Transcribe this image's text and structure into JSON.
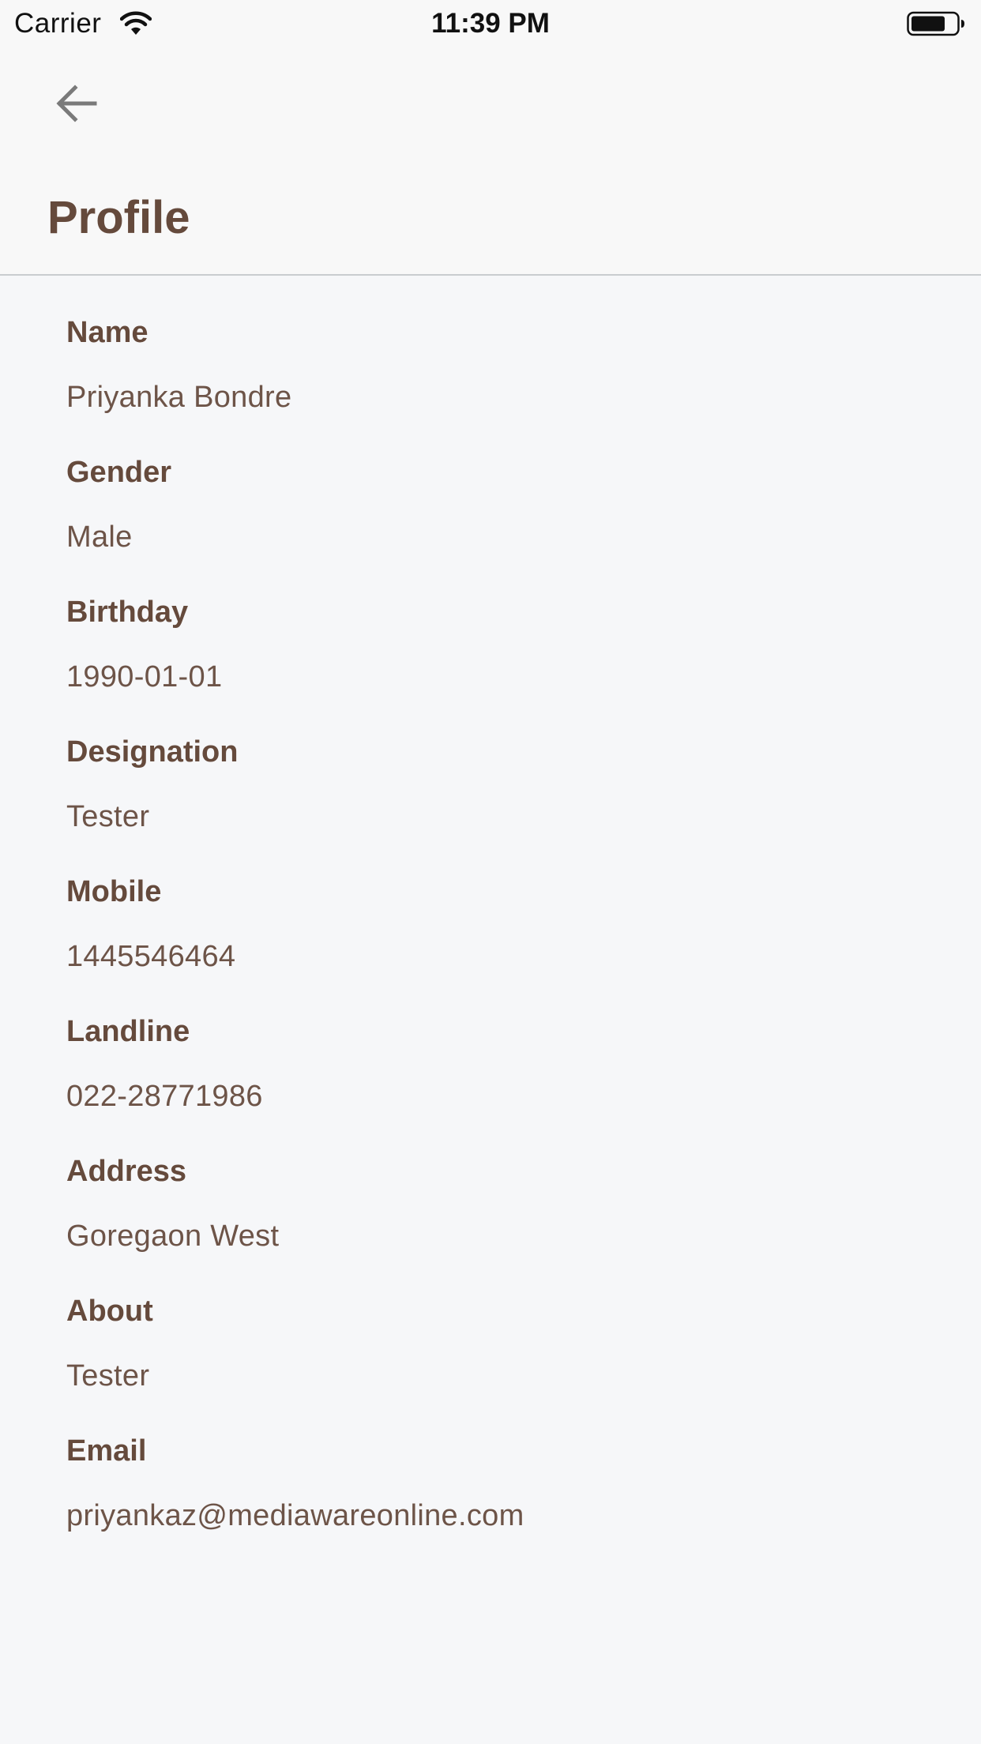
{
  "status_bar": {
    "carrier": "Carrier",
    "time": "11:39 PM"
  },
  "header": {
    "back_icon": "arrow-left-icon",
    "title": "Profile"
  },
  "fields": [
    {
      "label": "Name",
      "value": "Priyanka Bondre"
    },
    {
      "label": "Gender",
      "value": "Male"
    },
    {
      "label": "Birthday",
      "value": "1990-01-01"
    },
    {
      "label": "Designation",
      "value": "Tester"
    },
    {
      "label": "Mobile",
      "value": "1445546464"
    },
    {
      "label": "Landline",
      "value": "022-28771986"
    },
    {
      "label": "Address",
      "value": "Goregaon West"
    },
    {
      "label": "About",
      "value": "Tester"
    },
    {
      "label": "Email",
      "value": "priyankaz@mediawareonline.com"
    }
  ],
  "colors": {
    "accent": "#654a3c",
    "background": "#f6f7f9"
  }
}
